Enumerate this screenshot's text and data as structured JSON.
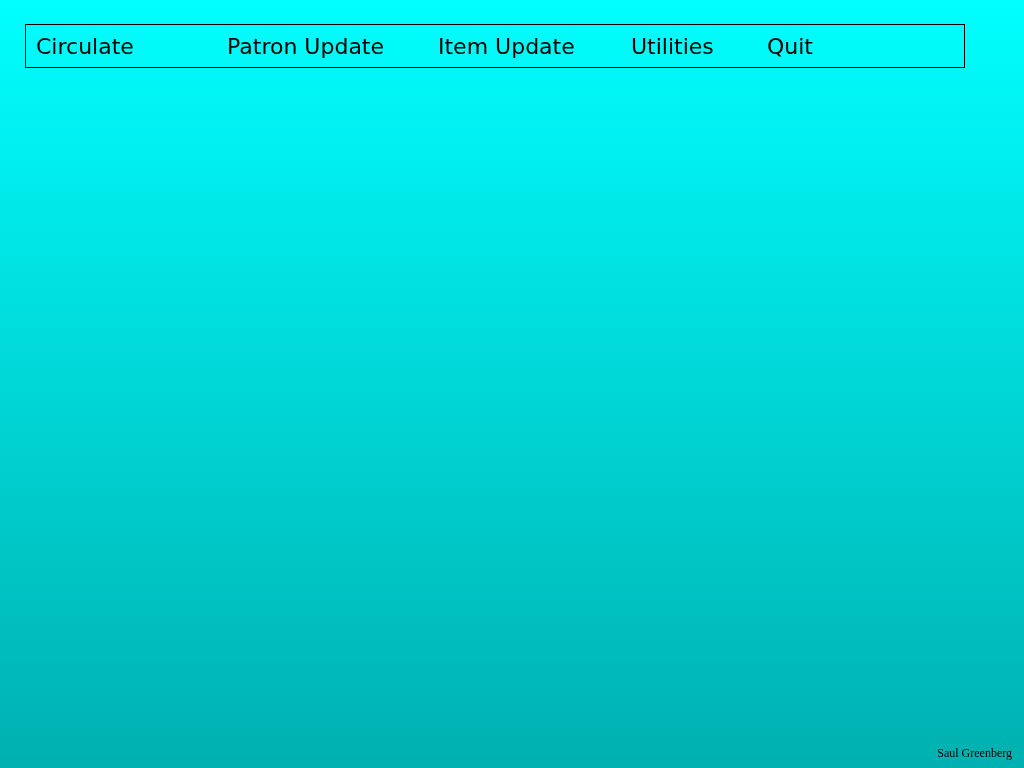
{
  "menu_bar": {
    "items": [
      {
        "label": "Circulate"
      },
      {
        "label": "Patron Update"
      },
      {
        "label": "Item Update"
      },
      {
        "label": "Utilities"
      },
      {
        "label": "Quit"
      }
    ]
  },
  "footer": {
    "author": "Saul Greenberg"
  }
}
